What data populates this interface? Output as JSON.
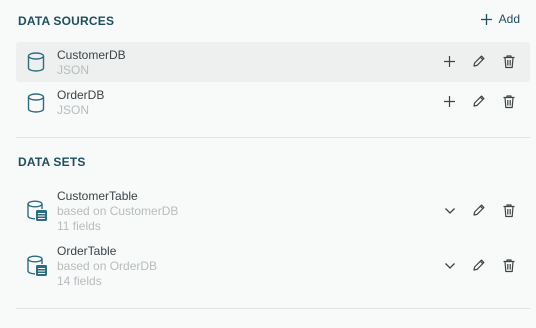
{
  "data_sources": {
    "title": "DATA SOURCES",
    "add_label": "Add",
    "items": [
      {
        "name": "CustomerDB",
        "type": "JSON",
        "highlighted": true
      },
      {
        "name": "OrderDB",
        "type": "JSON",
        "highlighted": false
      }
    ]
  },
  "data_sets": {
    "title": "DATA SETS",
    "items": [
      {
        "name": "CustomerTable",
        "based_on": "based on CustomerDB",
        "fields": "11 fields"
      },
      {
        "name": "OrderTable",
        "based_on": "based on OrderDB",
        "fields": "14 fields"
      }
    ]
  },
  "colors": {
    "accent": "#1d4f5e",
    "icon_teal": "#2f6d7e",
    "text": "#3c4447",
    "muted": "#b7bcbe",
    "highlight_row": "#eef0f0"
  },
  "icons": {
    "add": "plus-icon",
    "source": "database-icon",
    "dataset": "database-table-icon",
    "edit": "pencil-icon",
    "delete": "trash-icon",
    "expand": "chevron-down-icon"
  }
}
